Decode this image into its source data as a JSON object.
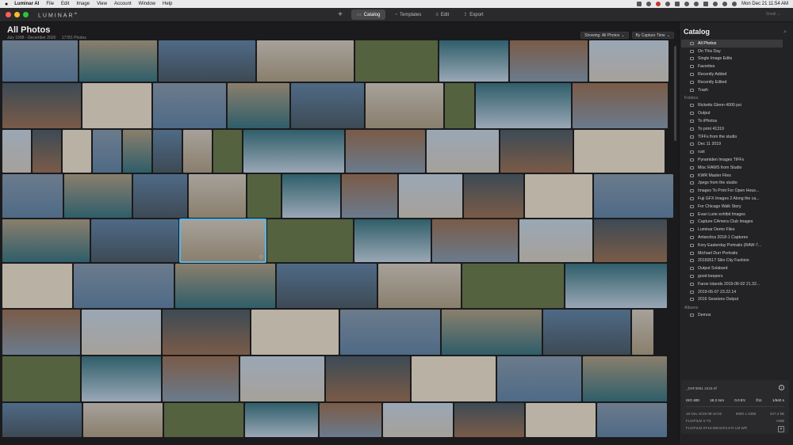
{
  "menubar": {
    "app_name": "Luminar AI",
    "menus": [
      "File",
      "Edit",
      "Image",
      "View",
      "Account",
      "Window",
      "Help"
    ],
    "clock": "Mon Dec 21  11:54 AM"
  },
  "toolbar": {
    "logo": "LUMINAR",
    "logo_sup": "AI",
    "tabs": [
      {
        "label": "Catalog",
        "icon": "catalog-icon",
        "glyph": "▭"
      },
      {
        "label": "Templates",
        "icon": "templates-icon",
        "glyph": "◔"
      },
      {
        "label": "Edit",
        "icon": "edit-icon",
        "glyph": "≡"
      },
      {
        "label": "Export",
        "icon": "export-icon",
        "glyph": "⇪"
      }
    ],
    "view_label": "Small ⌄"
  },
  "main": {
    "title": "All Photos",
    "date_range": "July 1998 - December 2020",
    "photo_count": "17781 Photos",
    "showing_label": "Showing: All Photos",
    "sort_label": "By Capture Time"
  },
  "sidebar": {
    "title": "Catalog",
    "library_items": [
      "All Photos",
      "On This Day",
      "Single Image Edits",
      "Favorites",
      "Recently Added",
      "Recently Edited",
      "Trash"
    ],
    "folders_label": "Folders",
    "folders": [
      "Ricketts Glenn 4000 psi",
      "Output",
      "To iPhotos",
      "To print 41319",
      "TIFFs from the studio",
      "Dec 11 2019",
      "rust",
      "Pyramiden Images TIFFs",
      "Misc RAWS from Studio",
      "KWR Master Files",
      "Jpegs from the studio",
      "Images To Print For Open Hous...",
      "Fuji GFX Images 2 Along the ca...",
      "For Chicago Walk Story",
      "Evan Lurie exhibit Images",
      "Capture CAmera Club Images",
      "Luminar Demo Files",
      "Antarctica 2018-1 Captures",
      "Kory Easterday Portraits (RAW-7...",
      "Michael Durr Portraits",
      "20150517 Silio City Fashion",
      "Output Svlabard",
      "good keepers",
      "Faroe Islands 2019-06-02 21.32...",
      "2019-06-07 23.22.14",
      "2016 Sessions Output"
    ],
    "albums_label": "Albums",
    "albums": [
      "Demos"
    ]
  },
  "info": {
    "filename": "_DSF3661 2215.rtf",
    "iso": "ISO 400",
    "focal": "18.2 mm",
    "ev": "0.0 EV",
    "aperture": "f/11",
    "shutter": "1/640 s",
    "date": "18 Nov 2018 08:44:02",
    "dimensions": "6000 x 2385",
    "filesize": "347.4 kB",
    "camera": "FUJIFILM X-T2",
    "format": "AWB",
    "lens": "FUJIFILM XF16-55mmF2.8 R LM WR"
  },
  "thumb_colors": [
    "#6b7b8c",
    "#8a7f6d",
    "#4f6a86",
    "#a6a19a",
    "#55623f",
    "#2f5e6a",
    "#7a5b48",
    "#9aa7b5",
    "#3d4a55",
    "#b8b1a4"
  ],
  "selected_color": "#56b6e8"
}
